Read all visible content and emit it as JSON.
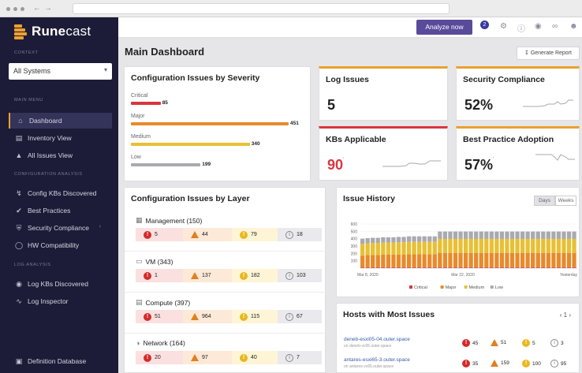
{
  "app": {
    "name_a": "Rune",
    "name_b": "cast",
    "context_label": "CONTEXT",
    "context_value": "All Systems",
    "sections": {
      "main": "MAIN MENU",
      "config": "CONFIGURATION ANALYSIS",
      "log": "LOG ANALYSIS"
    },
    "menu": [
      {
        "label": "Dashboard",
        "icon": "home-icon",
        "active": true
      },
      {
        "label": "Inventory View",
        "icon": "inventory-icon"
      },
      {
        "label": "All Issues View",
        "icon": "alert-icon"
      }
    ],
    "config_menu": [
      {
        "label": "Config KBs Discovered",
        "icon": "bolt-icon"
      },
      {
        "label": "Best Practices",
        "icon": "check-icon"
      },
      {
        "label": "Security Compliance",
        "icon": "shield-icon"
      },
      {
        "label": "HW Compatibility",
        "icon": "hw-icon"
      }
    ],
    "log_menu": [
      {
        "label": "Log KBs Discovered",
        "icon": "eye-icon"
      },
      {
        "label": "Log Inspector",
        "icon": "trend-icon"
      }
    ],
    "bottom_menu": {
      "label": "Definition Database",
      "icon": "database-icon"
    }
  },
  "topbar": {
    "analyze_label": "Analyze now",
    "notification_count": "2"
  },
  "page": {
    "title": "Main Dashboard",
    "generate_report": "Generate Report"
  },
  "severity": {
    "title": "Configuration Issues by Severity",
    "items": [
      {
        "label": "Critical",
        "value": 85,
        "color": "#d9363e"
      },
      {
        "label": "Major",
        "value": 451,
        "color": "#e88a2a"
      },
      {
        "label": "Medium",
        "value": 340,
        "color": "#e8c035"
      },
      {
        "label": "Low",
        "value": 199,
        "color": "#a9a9b0"
      }
    ],
    "max": 451
  },
  "stats": {
    "log_issues": {
      "label": "Log Issues",
      "value": "5"
    },
    "security": {
      "label": "Security Compliance",
      "value": "52%"
    },
    "kbs": {
      "label": "KBs Applicable",
      "value": "90"
    },
    "best_practice": {
      "label": "Best Practice Adoption",
      "value": "57%"
    }
  },
  "layers": {
    "title": "Configuration Issues by Layer",
    "items": [
      {
        "name": "Management (150)",
        "icon": "management-icon",
        "critical": "5",
        "major": "44",
        "medium": "79",
        "low": "18"
      },
      {
        "name": "VM (343)",
        "icon": "vm-icon",
        "critical": "1",
        "major": "137",
        "medium": "182",
        "low": "103"
      },
      {
        "name": "Compute (397)",
        "icon": "compute-icon",
        "critical": "51",
        "major": "964",
        "medium": "115",
        "low": "67"
      },
      {
        "name": "Network (164)",
        "icon": "network-icon",
        "critical": "20",
        "major": "97",
        "medium": "40",
        "low": "7"
      }
    ]
  },
  "history": {
    "title": "Issue History",
    "toggle_days": "Days",
    "toggle_weeks": "Weeks",
    "legend": [
      "Critical",
      "Major",
      "Medium",
      "Low"
    ],
    "x_start": "Mar 8, 2020",
    "x_mid": "Mar 22, 2020",
    "x_end": "Yesterday"
  },
  "chart_data": {
    "type": "bar",
    "title": "Issue History",
    "ylim": [
      0,
      600
    ],
    "yticks": [
      "600",
      "500",
      "400",
      "300",
      "200",
      "100"
    ],
    "x_labels": [
      "Mar 8, 2020",
      "Mar 22, 2020",
      "Yesterday"
    ],
    "series": [
      {
        "name": "Critical",
        "color": "#d9363e",
        "values": [
          10,
          12,
          12,
          12,
          12,
          12,
          12,
          12,
          12,
          12,
          12,
          12,
          12,
          12,
          12,
          12,
          12,
          12,
          12,
          12,
          12,
          12,
          12,
          12,
          12,
          12,
          12,
          12,
          12,
          12,
          12,
          12,
          12,
          12,
          12,
          12,
          12,
          12,
          12,
          12,
          12,
          12
        ]
      },
      {
        "name": "Major",
        "color": "#e88a2a",
        "values": [
          160,
          165,
          165,
          165,
          170,
          170,
          170,
          170,
          170,
          175,
          175,
          175,
          175,
          175,
          175,
          195,
          195,
          195,
          195,
          195,
          195,
          195,
          195,
          195,
          195,
          195,
          195,
          195,
          195,
          195,
          195,
          195,
          195,
          195,
          195,
          195,
          195,
          195,
          195,
          195,
          195,
          195
        ]
      },
      {
        "name": "Medium",
        "color": "#e8c035",
        "values": [
          160,
          160,
          165,
          165,
          165,
          165,
          165,
          170,
          170,
          170,
          170,
          170,
          170,
          170,
          170,
          190,
          190,
          190,
          190,
          190,
          190,
          190,
          190,
          190,
          190,
          190,
          190,
          190,
          190,
          190,
          190,
          190,
          190,
          190,
          190,
          190,
          190,
          190,
          190,
          190,
          190,
          190
        ]
      },
      {
        "name": "Low",
        "color": "#a9a9b0",
        "values": [
          70,
          70,
          70,
          70,
          72,
          72,
          72,
          72,
          72,
          75,
          75,
          75,
          75,
          75,
          75,
          100,
          100,
          100,
          100,
          100,
          100,
          100,
          100,
          100,
          100,
          100,
          100,
          100,
          100,
          100,
          100,
          100,
          100,
          100,
          100,
          100,
          100,
          100,
          100,
          100,
          100,
          100
        ]
      }
    ]
  },
  "hosts": {
    "title": "Hosts with Most Issues",
    "pager": "1",
    "items": [
      {
        "name": "deneb-esxi05-04.outer.space",
        "sub": "on deneb-vc05.outer.space",
        "critical": "45",
        "major": "51",
        "medium": "5",
        "low": "3"
      },
      {
        "name": "antares-esxi65-3.outer.space",
        "sub": "on antares-vc65.outer.space",
        "critical": "35",
        "major": "159",
        "medium": "100",
        "low": "95"
      }
    ]
  },
  "colors": {
    "sidebar": "#1c1c38",
    "accent": "#5a4a9a",
    "critical": "#d9363e",
    "major": "#e88a2a",
    "medium": "#e8c035",
    "low": "#a9a9b0"
  }
}
